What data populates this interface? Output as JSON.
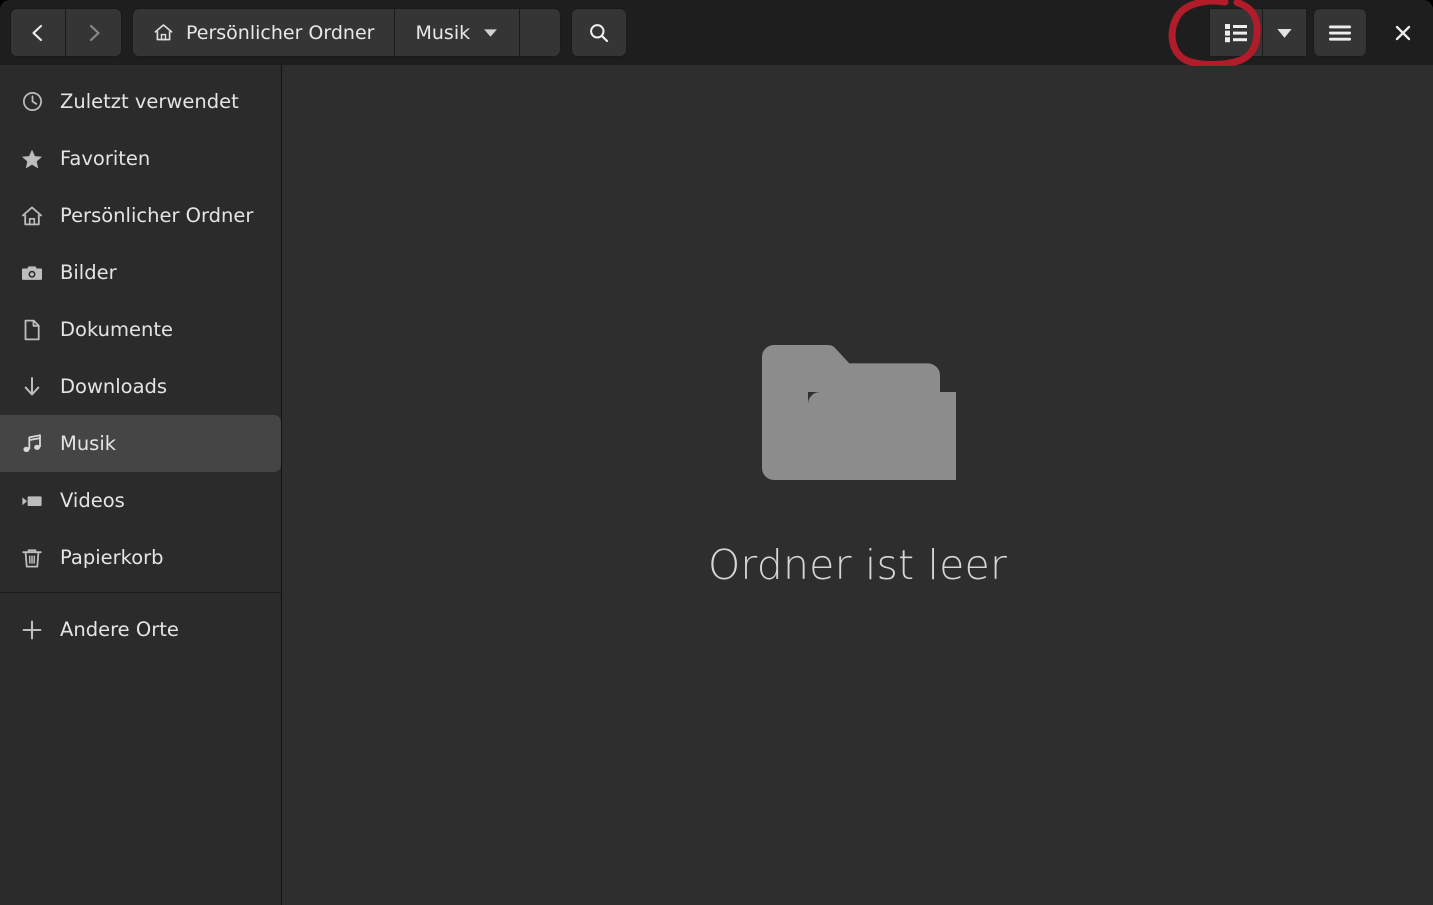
{
  "window": {
    "title": "Musik",
    "close_label": "×"
  },
  "header": {
    "nav": {
      "back": {
        "label": "‹",
        "icon": "chevron-left-icon",
        "enabled": true
      },
      "forward": {
        "label": "›",
        "icon": "chevron-right-icon",
        "enabled": false
      }
    },
    "pathbar": {
      "segments": [
        {
          "label": "Persönlicher Ordner",
          "icon": "home-icon"
        },
        {
          "label": "Musik",
          "icon": "chevron-down-icon"
        }
      ],
      "entry_value": "",
      "entry_placeholder": ""
    },
    "search_icon": "search-icon",
    "view_list_icon": "list-view-icon",
    "view_chevron_icon": "chevron-down-icon",
    "menu_icon": "hamburger-menu-icon",
    "close_icon": "close-icon"
  },
  "sidebar": {
    "items": [
      {
        "label": "Zuletzt verwendet",
        "icon": "clock-icon",
        "selected": false
      },
      {
        "label": "Favoriten",
        "icon": "star-icon",
        "selected": false
      },
      {
        "label": "Persönlicher Ordner",
        "icon": "home-icon",
        "selected": false
      },
      {
        "label": "Bilder",
        "icon": "camera-icon",
        "selected": false
      },
      {
        "label": "Dokumente",
        "icon": "document-icon",
        "selected": false
      },
      {
        "label": "Downloads",
        "icon": "download-arrow-icon",
        "selected": false
      },
      {
        "label": "Musik",
        "icon": "music-note-icon",
        "selected": true
      },
      {
        "label": "Videos",
        "icon": "video-icon",
        "selected": false
      },
      {
        "label": "Papierkorb",
        "icon": "trash-icon",
        "selected": false
      }
    ],
    "other_places": {
      "label": "Andere Orte",
      "icon": "plus-icon"
    }
  },
  "content": {
    "empty_state": {
      "icon": "empty-folder-icon",
      "message": "Ordner ist leer"
    }
  },
  "annotation": {
    "shape": "hand-drawn-circle",
    "color": "#b01c29",
    "target": "list-view-icon"
  },
  "colors": {
    "header_bg": "#1e1e1e",
    "sidebar_bg": "#2b2b2b",
    "content_bg": "#2e2e2e",
    "button_bg": "#353535",
    "selected_bg": "#454545",
    "text": "#e4e4e4",
    "folder_icon": "#8c8c8c",
    "annotation_red": "#b01c29"
  }
}
